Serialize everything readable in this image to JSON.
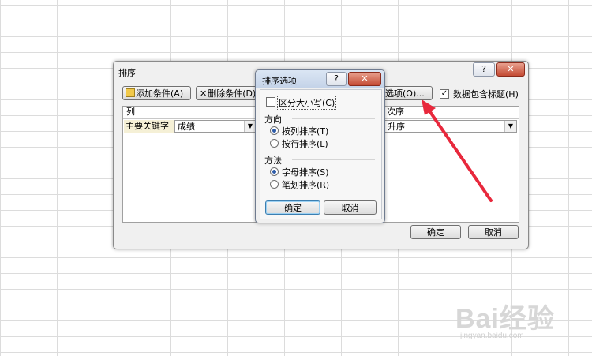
{
  "sort_dialog": {
    "title": "排序",
    "help": "?",
    "close": "✕",
    "add_condition": "添加条件(A)",
    "delete_condition": "删除条件(D)",
    "options_button": "选项(O)...",
    "header_checkbox_label": "数据包含标题(H)",
    "header_checked": true,
    "col_header": "列",
    "order_header": "次序",
    "primary_key_label": "主要关键字",
    "primary_key_value": "成绩",
    "order_value": "升序",
    "ok": "确定",
    "cancel": "取消"
  },
  "options_dialog": {
    "title": "排序选项",
    "help": "?",
    "close": "✕",
    "case_sensitive_label": "区分大小写(C)",
    "case_sensitive_checked": false,
    "direction_title": "方向",
    "direction_options": [
      {
        "label": "按列排序(T)",
        "selected": true
      },
      {
        "label": "按行排序(L)",
        "selected": false
      }
    ],
    "method_title": "方法",
    "method_options": [
      {
        "label": "字母排序(S)",
        "selected": true
      },
      {
        "label": "笔划排序(R)",
        "selected": false
      }
    ],
    "ok": "确定",
    "cancel": "取消"
  },
  "annotation": {
    "arrow_color": "#e8283c"
  },
  "watermark": {
    "logo": "Bai经验",
    "url": "jingyan.baidu.com"
  }
}
